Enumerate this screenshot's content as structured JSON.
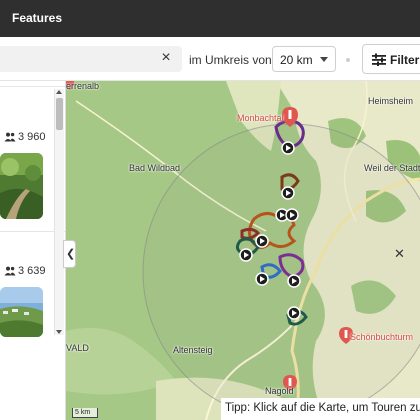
{
  "header": {
    "title": "Features"
  },
  "filter": {
    "radius_label": "im Umkreis von",
    "radius_value": "20 km",
    "clear_symbol": "×",
    "filter_button": "Filter"
  },
  "list": {
    "items": [
      {
        "count": "3 960"
      },
      {
        "count": "3 639"
      }
    ]
  },
  "map": {
    "labels": {
      "herrenalb": "errenalb",
      "monbachtal": "Monbachtal",
      "heimsheim": "Heimsheim",
      "bad_wildbad": "Bad Wildbad",
      "weil_der_stadt": "Weil der Stadt",
      "wald": "VALD",
      "altensteig": "Altensteig",
      "schoenbuchturm": "Schönbuchturm",
      "nagold": "Nagold"
    },
    "scale": "5 km",
    "tip": "Tipp: Klick auf die Karte, um Touren zu suchen"
  },
  "colors": {
    "header_bg": "#2f2f2f",
    "forest": "#a5c886",
    "field": "#e7e9c8",
    "marker_red": "#e0574f"
  },
  "icons": {
    "clear": "close-icon",
    "filter": "sliders-icon",
    "count": "people-icon",
    "collapse": "chevron-left-icon",
    "marker": "play-icon",
    "poi": "hiker-pin-icon"
  }
}
